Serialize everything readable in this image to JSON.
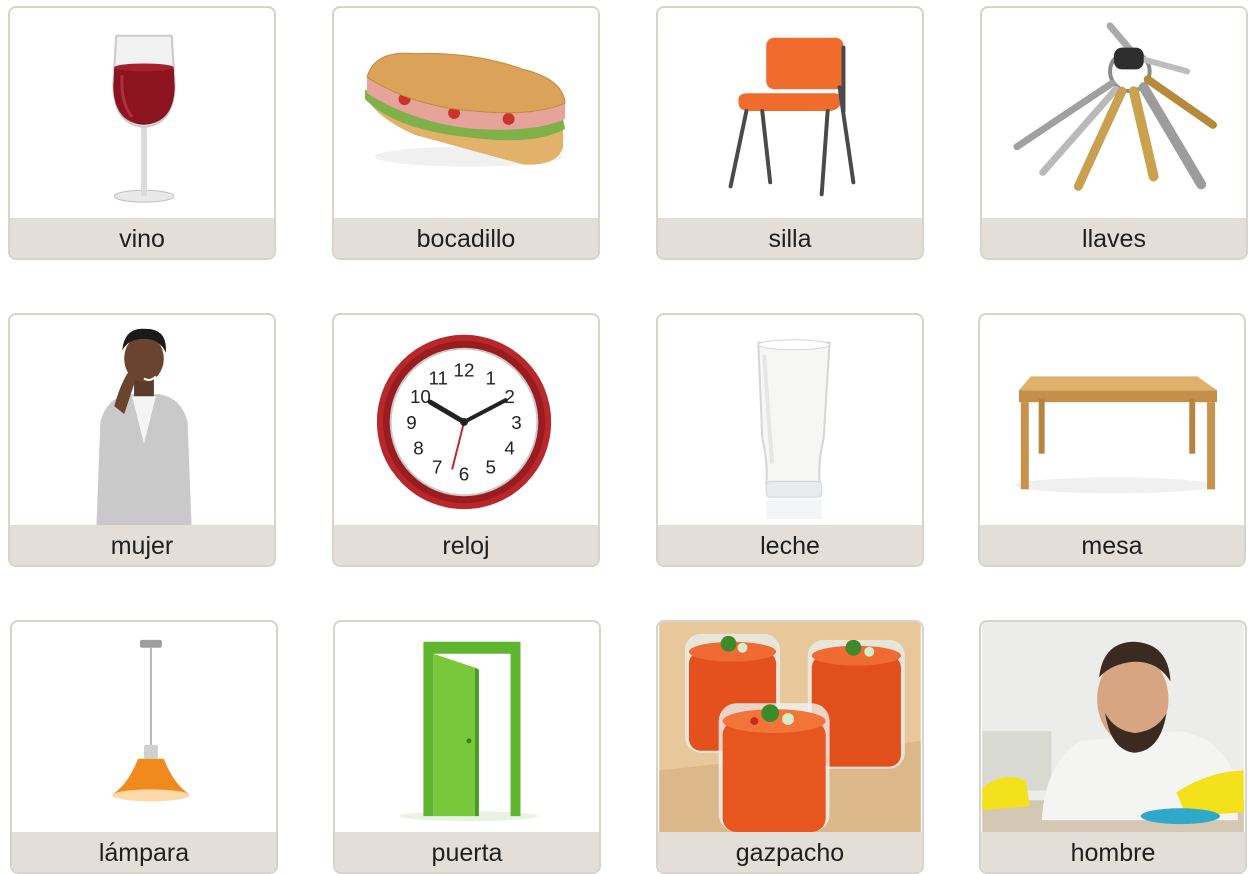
{
  "cards": [
    {
      "word": "vino",
      "icon": "wine-glass-icon"
    },
    {
      "word": "bocadillo",
      "icon": "sandwich-icon"
    },
    {
      "word": "silla",
      "icon": "chair-icon"
    },
    {
      "word": "llaves",
      "icon": "keys-icon"
    },
    {
      "word": "mujer",
      "icon": "woman-icon"
    },
    {
      "word": "reloj",
      "icon": "clock-icon"
    },
    {
      "word": "leche",
      "icon": "milk-glass-icon"
    },
    {
      "word": "mesa",
      "icon": "table-icon"
    },
    {
      "word": "lámpara",
      "icon": "lamp-icon"
    },
    {
      "word": "puerta",
      "icon": "door-icon"
    },
    {
      "word": "gazpacho",
      "icon": "gazpacho-icon"
    },
    {
      "word": "hombre",
      "icon": "man-icon"
    }
  ],
  "clock": {
    "numbers": [
      "12",
      "1",
      "2",
      "3",
      "4",
      "5",
      "6",
      "7",
      "8",
      "9",
      "10",
      "11"
    ]
  },
  "colors": {
    "label_bg": "#e3dfd8",
    "card_border": "#d8d4cc",
    "text": "#1e1e1e"
  }
}
